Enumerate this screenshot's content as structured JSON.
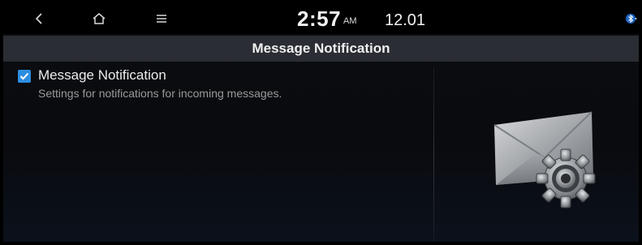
{
  "status_bar": {
    "back_icon": "chevron-left-icon",
    "home_icon": "home-icon",
    "menu_icon": "menu-icon",
    "time": "2:57",
    "am_pm": "AM",
    "date": "12.01",
    "bluetooth_icon": "bluetooth-icon"
  },
  "header": {
    "title": "Message Notification"
  },
  "option": {
    "checked": true,
    "title": "Message Notification",
    "description": "Settings for notifications for incoming messages."
  },
  "colors": {
    "accent": "#2c8ee0",
    "title_bar": "#2a2d33"
  },
  "illustration": {
    "icon": "envelope-gear-icon"
  }
}
